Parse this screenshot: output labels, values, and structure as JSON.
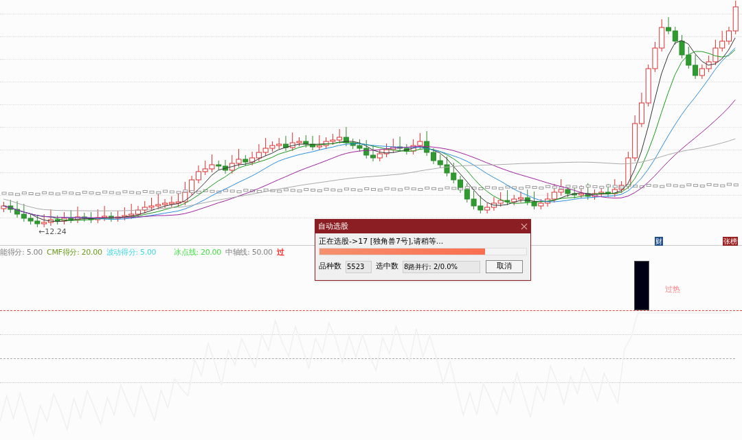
{
  "price_chart": {
    "low_label": "←12.24",
    "markers": [
      {
        "text": "财",
        "color": "#1f4e8c"
      },
      {
        "text": "张榜",
        "color": "#9b1c1c"
      }
    ]
  },
  "indicators": [
    {
      "text": "能得分: 5.00",
      "color": "#808080"
    },
    {
      "text": "CMF得分: 20.00",
      "color": "#6a9a1a"
    },
    {
      "text": "波动得分: 5.00",
      "color": "#3fd8e0"
    },
    {
      "text": "冰点线: 20.00",
      "color": "#44e044"
    },
    {
      "text": "中轴线: 50.00",
      "color": "#808080"
    },
    {
      "text": "过",
      "color": "#ff2020"
    }
  ],
  "lower_panel": {
    "label": "过热"
  },
  "dialog": {
    "title": "自动选股",
    "message": "正在选股->17 [独角兽7号],请稍等...",
    "progress": {
      "level": 0.8
    },
    "fields": [
      {
        "label": "品种数",
        "value": "5523"
      },
      {
        "label": "选中数",
        "value": "8路并行: 2/0.0%"
      }
    ],
    "buttons": [
      "取消"
    ]
  }
}
